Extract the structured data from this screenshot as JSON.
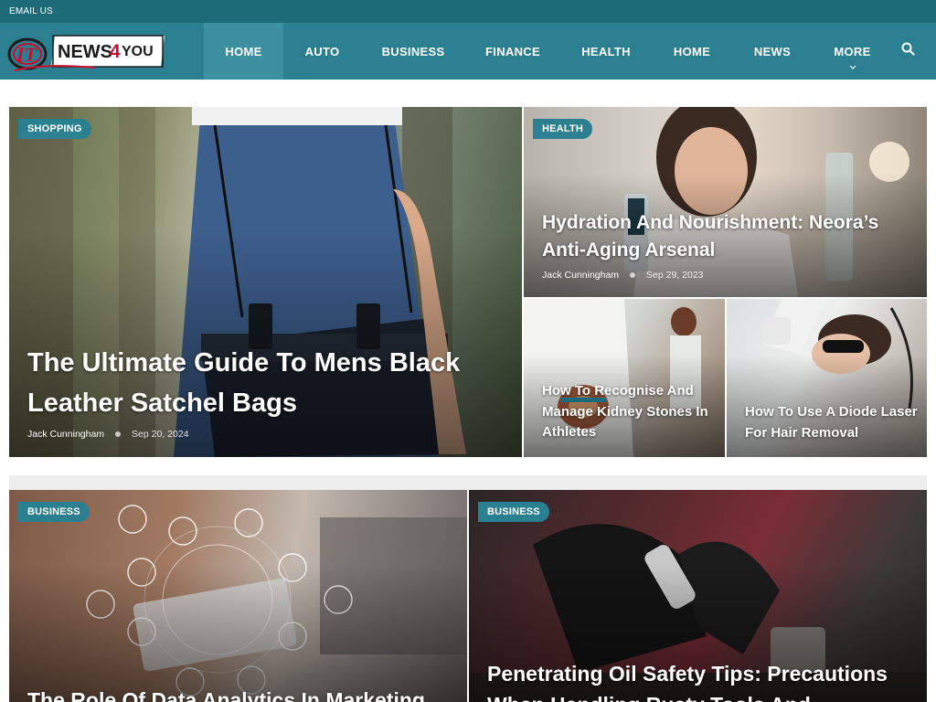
{
  "topbar": {
    "email_label": "EMAIL US",
    "bg_color": "#1e6c7a"
  },
  "header": {
    "brand_color": "#2a8091",
    "logo": {
      "it": "IT",
      "news": "NEWS",
      "four": "4",
      "you": "YOU"
    },
    "nav": [
      {
        "label": "HOME",
        "active": true
      },
      {
        "label": "AUTO"
      },
      {
        "label": "BUSINESS"
      },
      {
        "label": "FINANCE"
      },
      {
        "label": "HEALTH"
      },
      {
        "label": "HOME"
      },
      {
        "label": "NEWS"
      },
      {
        "label": "MORE",
        "chevron": "chevron-down-icon"
      }
    ],
    "search_icon": "search-icon"
  },
  "featured": {
    "main": {
      "category": "SHOPPING",
      "title": "The Ultimate Guide To Mens Black Leather Satchel Bags",
      "author": "Jack Cunningham",
      "date": "Sep 20, 2024"
    },
    "top_right": {
      "category": "HEALTH",
      "title": "Hydration And Nourishment: Neora’s Anti-Aging Arsenal",
      "author": "Jack Cunningham",
      "date": "Sep 29, 2023"
    },
    "bottom_left": {
      "title": "How To Recognise And Manage Kidney Stones In Athletes"
    },
    "bottom_right": {
      "title": "How To Use A Diode Laser For Hair Removal"
    }
  },
  "second_row": [
    {
      "category": "BUSINESS",
      "title": "The Role Of Data Analytics In Marketing"
    },
    {
      "category": "BUSINESS",
      "title": "Penetrating Oil Safety Tips: Precautions When Handling Rusty Tools And"
    }
  ]
}
